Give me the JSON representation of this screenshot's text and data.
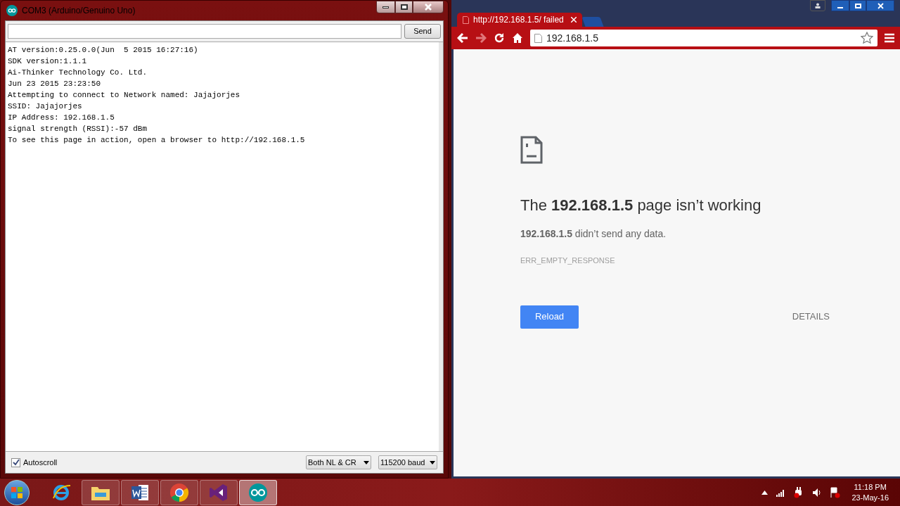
{
  "serial_monitor": {
    "title": "COM3 (Arduino/Genuino Uno)",
    "send_button": "Send",
    "output_lines": [
      "AT version:0.25.0.0(Jun  5 2015 16:27:16)",
      "SDK version:1.1.1",
      "Ai-Thinker Technology Co. Ltd.",
      "Jun 23 2015 23:23:50",
      "Attempting to connect to Network named: Jajajorjes",
      "SSID: Jajajorjes",
      "IP Address: 192.168.1.5",
      "signal strength (RSSI):-57 dBm",
      "To see this page in action, open a browser to http://192.168.1.5"
    ],
    "autoscroll": {
      "label": "Autoscroll",
      "checked": true
    },
    "line_ending": "Both NL & CR",
    "baud_rate": "115200 baud"
  },
  "browser": {
    "tabs": [
      {
        "title": "http://192.168.1.5/ failed",
        "selected": true
      },
      {
        "selected": false
      }
    ],
    "address": "192.168.1.5",
    "error": {
      "heading": "The **192.168.1.5** page isn’t working",
      "message": "**192.168.1.5** didn’t send any data.",
      "code": "ERR_EMPTY_RESPONSE",
      "reload_button": "Reload",
      "details_button": "DETAILS"
    }
  },
  "taskbar": {
    "apps": [
      {
        "kind": "ie",
        "selected": false
      },
      {
        "kind": "explorer",
        "selected": false
      },
      {
        "kind": "word",
        "selected": false
      },
      {
        "kind": "chrome",
        "selected": false
      },
      {
        "kind": "vs",
        "selected": false
      },
      {
        "kind": "arduino",
        "selected": true
      }
    ],
    "time": "11:18 PM",
    "date": "23-May-16"
  }
}
